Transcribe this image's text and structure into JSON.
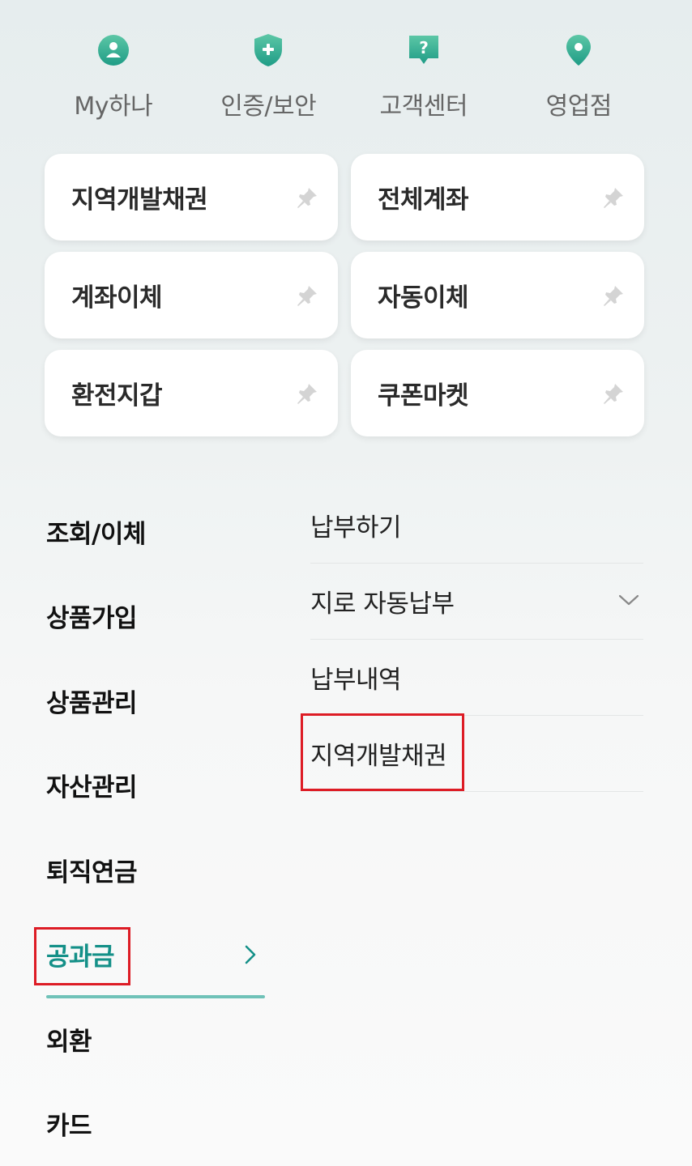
{
  "quick_nav": [
    {
      "label": "My하나",
      "icon": "user-icon"
    },
    {
      "label": "인증/보안",
      "icon": "shield-plus-icon"
    },
    {
      "label": "고객센터",
      "icon": "help-chat-icon"
    },
    {
      "label": "영업점",
      "icon": "location-pin-icon"
    }
  ],
  "favorites": [
    {
      "label": "지역개발채권",
      "icon": "pin-icon"
    },
    {
      "label": "전체계좌",
      "icon": "pin-icon"
    },
    {
      "label": "계좌이체",
      "icon": "pin-icon"
    },
    {
      "label": "자동이체",
      "icon": "pin-icon"
    },
    {
      "label": "환전지갑",
      "icon": "pin-icon"
    },
    {
      "label": "쿠폰마켓",
      "icon": "pin-icon"
    }
  ],
  "categories": [
    {
      "label": "조회/이체"
    },
    {
      "label": "상품가입"
    },
    {
      "label": "상품관리"
    },
    {
      "label": "자산관리"
    },
    {
      "label": "퇴직연금"
    },
    {
      "label": "공과금",
      "active": true
    },
    {
      "label": "외환"
    },
    {
      "label": "카드"
    }
  ],
  "submenu": [
    {
      "label": "납부하기"
    },
    {
      "label": "지로 자동납부",
      "icon": "chevron-down-icon"
    },
    {
      "label": "납부내역"
    },
    {
      "label": "지역개발채권",
      "highlighted": true
    }
  ],
  "colors": {
    "accent": "#149088",
    "accent_underline": "#6fc2b8",
    "icon_green": "#2aa98f",
    "highlight_red": "#dd1c25",
    "pin_gray": "#d4d4d4"
  }
}
